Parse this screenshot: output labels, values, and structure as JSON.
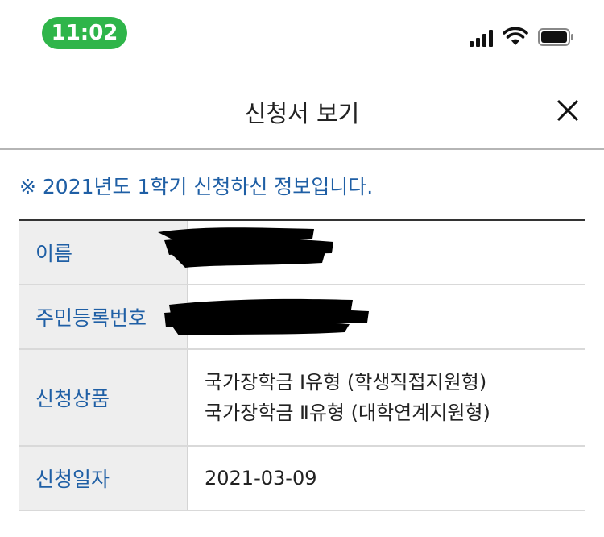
{
  "status_bar": {
    "time": "11:02",
    "icons": [
      "signal-icon",
      "wifi-icon",
      "battery-icon"
    ]
  },
  "header": {
    "title": "신청서 보기",
    "close_icon": "close-icon"
  },
  "notice": "※ 2021년도 1학기 신청하신 정보입니다.",
  "info": {
    "name_label": "이름",
    "rrn_label": "주민등록번호",
    "product_label": "신청상품",
    "product_lines": [
      "국가장학금 Ⅰ유형 (학생직접지원형)",
      "국가장학금 Ⅱ유형 (대학연계지원형)"
    ],
    "date_label": "신청일자",
    "date_value": "2021-03-09"
  },
  "colors": {
    "time_pill": "#2fb54a",
    "accent_text": "#1f5fa5",
    "label_bg": "#eeeeee"
  }
}
